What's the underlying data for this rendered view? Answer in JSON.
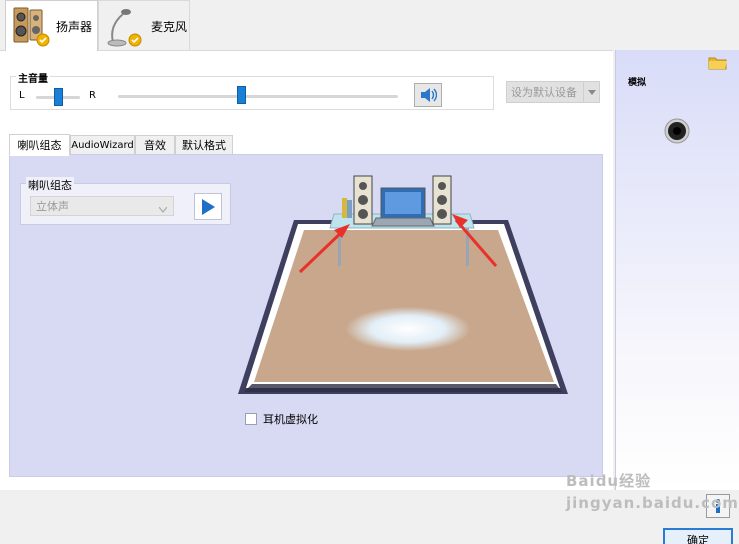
{
  "tabs": [
    {
      "label": "扬声器",
      "icon": "speaker-icon"
    },
    {
      "label": "麦克风",
      "icon": "microphone-icon"
    }
  ],
  "master_volume": {
    "title": "主音量",
    "left_label": "L",
    "right_label": "R",
    "balance": 0.5,
    "level": 0.44,
    "mute_icon": "volume-icon"
  },
  "set_default_label": "设为默认设备",
  "sub_tabs": [
    "喇叭组态",
    "AudioWizard",
    "音效",
    "默认格式"
  ],
  "speaker_config": {
    "group_title": "喇叭组态",
    "selected": "立体声",
    "play_icon": "play-icon"
  },
  "headphone_virtualization_label": "耳机虚拟化",
  "right_panel": {
    "label": "模拟",
    "folder_icon": "folder-icon",
    "jack_icon": "audio-jack-icon"
  },
  "ok_button": "确定",
  "info_icon": "info-icon",
  "watermark": "Baidu经验 jingyan.baidu.com"
}
